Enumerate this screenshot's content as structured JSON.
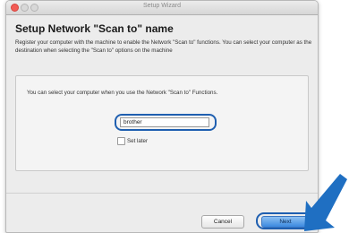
{
  "window": {
    "title": "Setup Wizard"
  },
  "dialog": {
    "heading": "Setup Network \"Scan to\" name",
    "description": "Register your computer with the machine to enable the Network \"Scan to\" functions. You can select your computer as the destination when selecting the \"Scan to\" options on the machine",
    "panel_text": "You can select your computer when you use the Network \"Scan to\" Functions.",
    "name_field": {
      "value": "brother"
    },
    "set_later": {
      "label": "Set later",
      "checked": false
    },
    "buttons": {
      "cancel": "Cancel",
      "next": "Next"
    }
  },
  "colors": {
    "highlight": "#1f5fb0",
    "arrow": "#1f6fc2",
    "close": "#f25b55"
  }
}
